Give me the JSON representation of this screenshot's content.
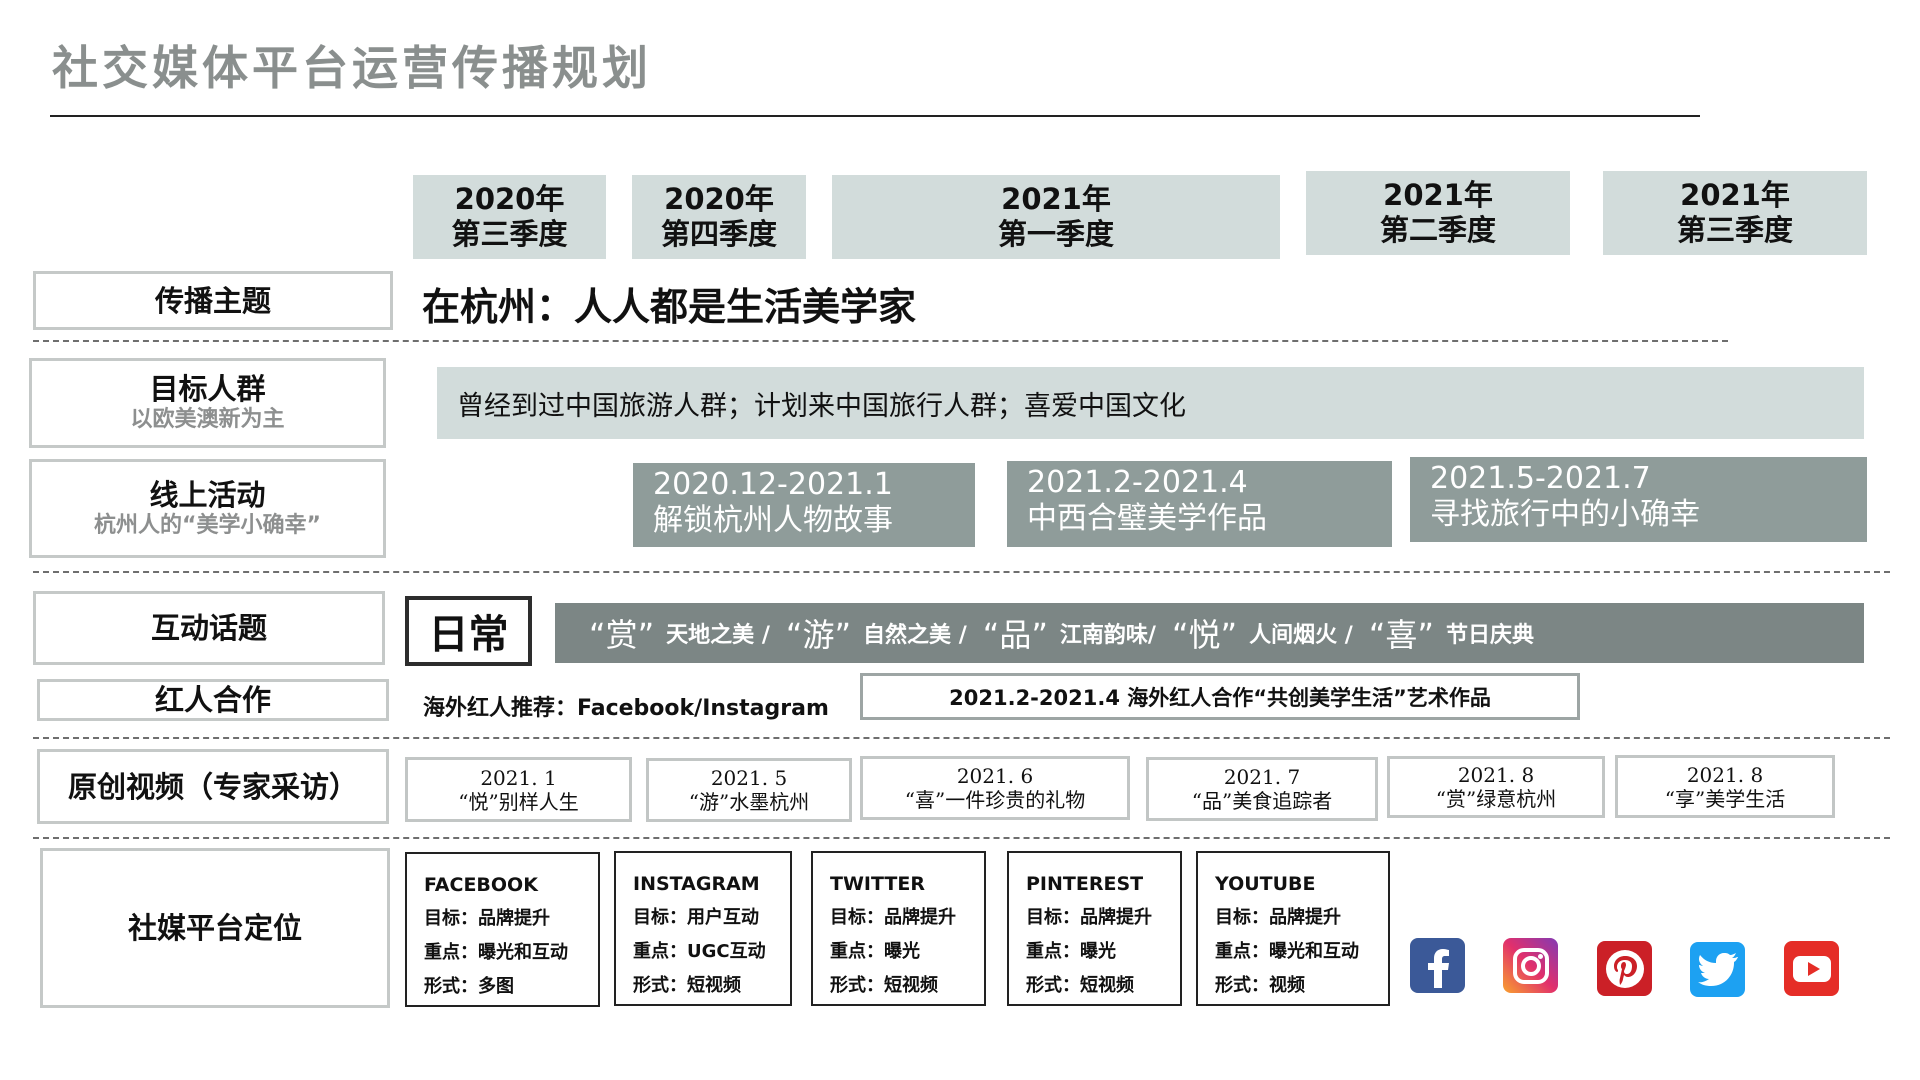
{
  "title": "社交媒体平台运营传播规划",
  "quarters": [
    {
      "year": "2020年",
      "quarter": "第三季度"
    },
    {
      "year": "2020年",
      "quarter": "第四季度"
    },
    {
      "year": "2021年",
      "quarter": "第一季度"
    },
    {
      "year": "2021年",
      "quarter": "第二季度"
    },
    {
      "year": "2021年",
      "quarter": "第三季度"
    }
  ],
  "rows": {
    "theme_label": "传播主题",
    "audience_label": "目标人群",
    "audience_sub": "以欧美澳新为主",
    "online_label": "线上活动",
    "online_sub": "杭州人的“美学小确幸”",
    "topic_label": "互动话题",
    "kol_label": "红人合作",
    "video_label": "原创视频（专家采访）",
    "platform_label": "社媒平台定位"
  },
  "theme_text": "在杭州：人人都是生活美学家",
  "audience_text": "曾经到过中国旅游人群；计划来中国旅行人群；喜爱中国文化",
  "activities": [
    {
      "date": "2020.12-2021.1",
      "name": "解锁杭州人物故事"
    },
    {
      "date": "2021.2-2021.4",
      "name": "中西合璧美学作品"
    },
    {
      "date": "2021.5-2021.7",
      "name": "寻找旅行中的小确幸"
    }
  ],
  "daily_label": "日常",
  "topics": [
    {
      "word": "“赏”",
      "desc": "天地之美 /"
    },
    {
      "word": "“游”",
      "desc": "自然之美 /"
    },
    {
      "word": "“品”",
      "desc": "江南韵味/"
    },
    {
      "word": "“悦”",
      "desc": "人间烟火 /"
    },
    {
      "word": "“喜”",
      "desc": "节日庆典"
    }
  ],
  "kol_text": "海外红人推荐：Facebook/Instagram",
  "kol_box": "2021.2-2021.4  海外红人合作“共创美学生活”艺术作品",
  "videos": [
    {
      "date": "2021. 1",
      "title": "“悦”别样人生"
    },
    {
      "date": "2021. 5",
      "title": "“游”水墨杭州"
    },
    {
      "date": "2021. 6",
      "title": "“喜”一件珍贵的礼物"
    },
    {
      "date": "2021. 7",
      "title": "“品”美食追踪者"
    },
    {
      "date": "2021. 8",
      "title": "“赏”绿意杭州"
    },
    {
      "date": "2021. 8",
      "title": "“享”美学生活"
    }
  ],
  "platforms": [
    {
      "name": "FACEBOOK",
      "goal": "目标：品牌提升",
      "focus": "重点：曝光和互动",
      "form": "形式：多图"
    },
    {
      "name": "INSTAGRAM",
      "goal": "目标：用户互动",
      "focus": "重点：UGC互动",
      "form": "形式：短视频"
    },
    {
      "name": "TWITTER",
      "goal": "目标：品牌提升",
      "focus": "重点：曝光",
      "form": "形式：短视频"
    },
    {
      "name": "PINTEREST",
      "goal": "目标：品牌提升",
      "focus": "重点：曝光",
      "form": "形式：短视频"
    },
    {
      "name": "YOUTUBE",
      "goal": "目标：品牌提升",
      "focus": "重点：曝光和互动",
      "form": "形式：视频"
    }
  ],
  "icons": [
    "facebook-icon",
    "instagram-icon",
    "pinterest-icon",
    "twitter-icon",
    "youtube-icon"
  ],
  "colors": {
    "title_gray": "#8a8f8e",
    "light_teal": "#d2dcdb",
    "activity_gray": "#8f9c9a",
    "topic_gray": "#7c8685",
    "facebook": "#3b5998",
    "pinterest": "#cb2027",
    "twitter": "#1da1f2",
    "youtube": "#e52d27"
  }
}
